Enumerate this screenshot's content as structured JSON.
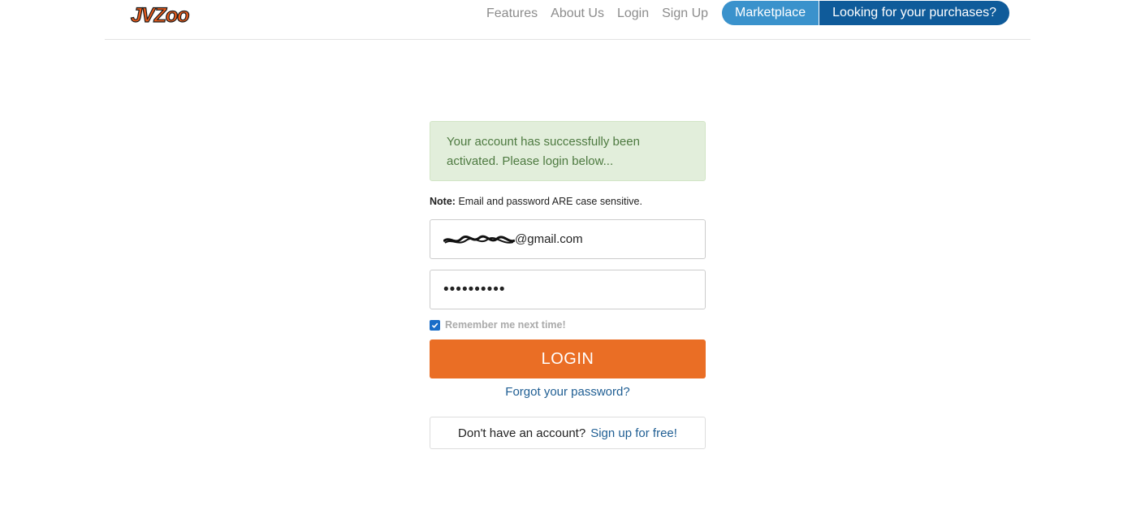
{
  "header": {
    "logo_text": "JVZoo",
    "nav": [
      "Features",
      "About Us",
      "Login",
      "Sign Up"
    ],
    "marketplace_label": "Marketplace",
    "purchases_label": "Looking for your purchases?"
  },
  "alert": {
    "message": "Your account has successfully been activated. Please login below..."
  },
  "note": {
    "label": "Note:",
    "text": "Email and password ARE case sensitive."
  },
  "form": {
    "email_value": "@gmail.com",
    "password_value": "••••••••••",
    "remember_label": "Remember me next time!",
    "remember_checked": true,
    "login_label": "LOGIN",
    "forgot_label": "Forgot your password?"
  },
  "signup": {
    "prompt": "Don't have an account?",
    "link": "Sign up for free!"
  },
  "colors": {
    "primary_orange": "#ea6e25",
    "pill_light_blue": "#3a92cc",
    "pill_dark_blue": "#0f5b9a",
    "alert_bg": "#e2eedb",
    "link_blue": "#1f5e93"
  }
}
